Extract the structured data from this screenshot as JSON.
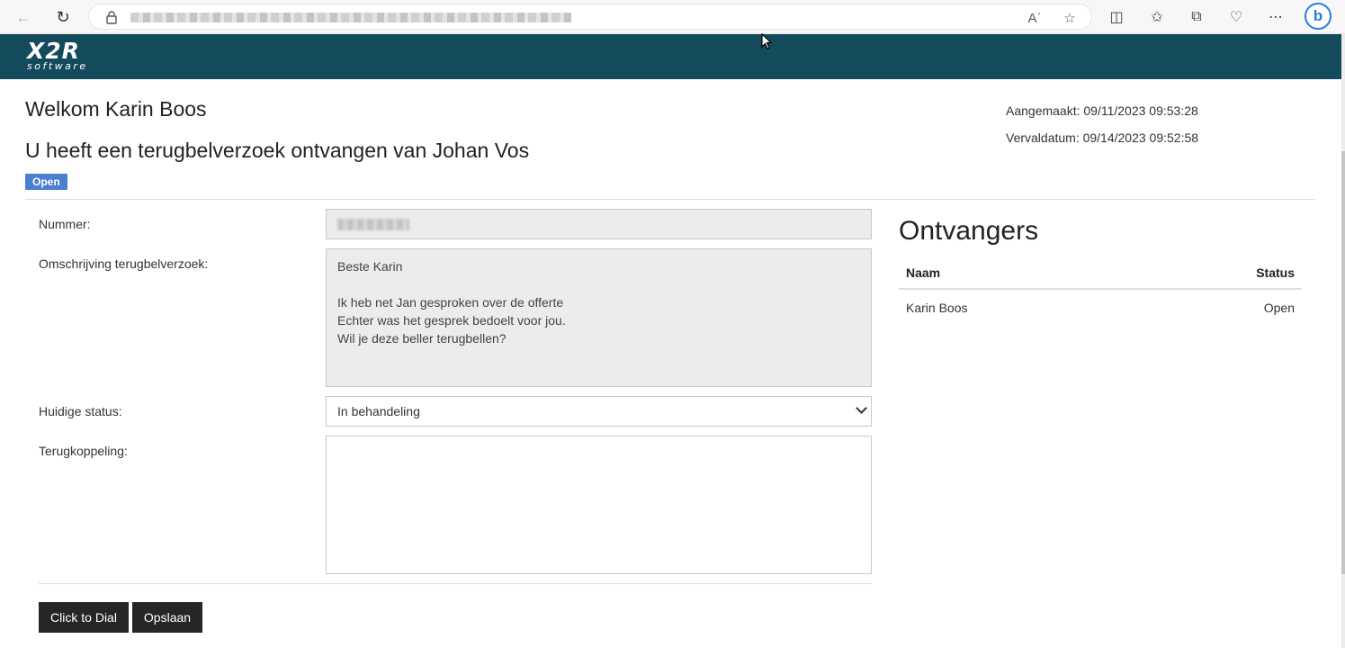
{
  "app": {
    "logo_main": "X2R",
    "logo_sub": "software"
  },
  "page": {
    "welcome": "Welkom Karin Boos",
    "subtitle": "U heeft een terugbelverzoek ontvangen van Johan Vos",
    "status_badge": "Open",
    "created_label": "Aangemaakt: 09/11/2023 09:53:28",
    "due_label": "Vervaldatum: 09/14/2023 09:52:58"
  },
  "form": {
    "number_label": "Nummer:",
    "description_label": "Omschrijving terugbelverzoek:",
    "description_value": "Beste Karin\n\nIk heb net Jan gesproken over de offerte\nEchter was het gesprek bedoelt voor jou.\nWil je deze beller terugbellen?",
    "status_label": "Huidige status:",
    "status_value": "In behandeling",
    "feedback_label": "Terugkoppeling:",
    "feedback_value": ""
  },
  "buttons": {
    "dial": "Click to Dial",
    "save": "Opslaan"
  },
  "recipients": {
    "title": "Ontvangers",
    "col_name": "Naam",
    "col_status": "Status",
    "rows": [
      {
        "name": "Karin Boos",
        "status": "Open"
      }
    ]
  },
  "colors": {
    "header_bg": "#134a5c",
    "badge_bg": "#4a7fd1",
    "button_bg": "#262626"
  }
}
